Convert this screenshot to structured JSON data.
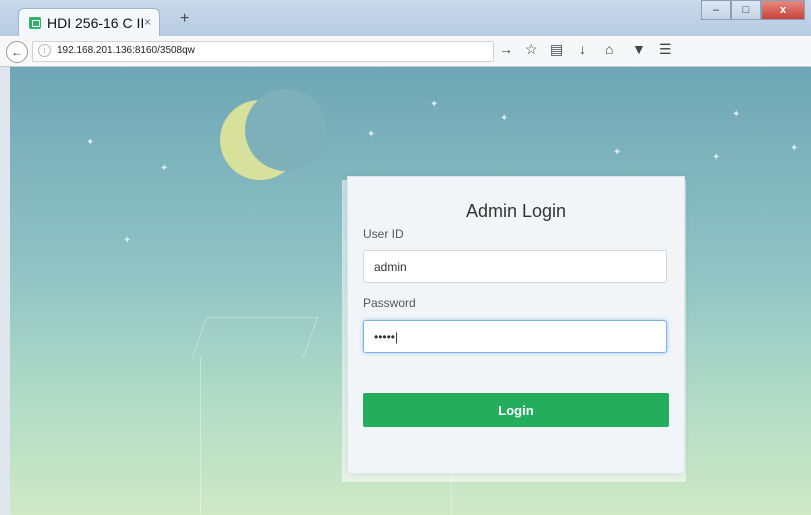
{
  "browser": {
    "tab_title": "HDI 256-16 C II",
    "tab_close": "×",
    "new_tab": "+",
    "url": "192.168.201.136:8160/3508qw",
    "window_buttons": {
      "minimize": "–",
      "maximize": "□",
      "close": "x"
    }
  },
  "login": {
    "title": "Admin Login",
    "user_label": "User ID",
    "user_value": "admin",
    "password_label": "Password",
    "password_value": "•••••|",
    "button_label": "Login"
  },
  "colors": {
    "accent_button": "#25ad5e",
    "sky_top": "#6fa6b5",
    "moon": "#d7e19b"
  },
  "icons": [
    "favicon-icon",
    "back-arrow-icon",
    "info-icon",
    "arrow-right-icon",
    "star-bookmark-icon",
    "reading-list-icon",
    "download-icon",
    "home-icon",
    "pocket-icon",
    "menu-icon"
  ]
}
